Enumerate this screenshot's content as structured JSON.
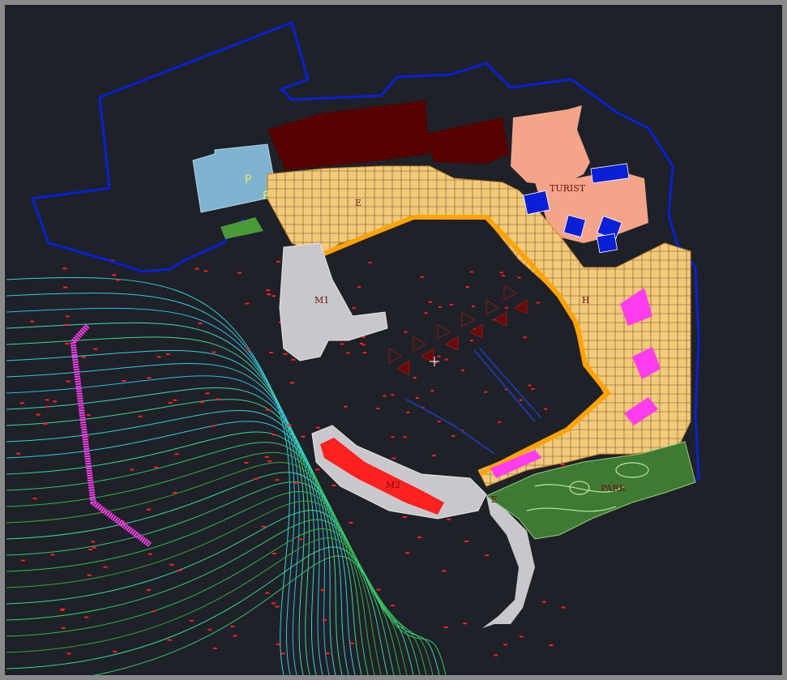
{
  "map": {
    "colors": {
      "background": "#1e2127",
      "frame": "#8a8a8a",
      "boundary": "#0a1fd8",
      "quay_fill": "#f3c97a",
      "breakwater_outline": "#ffa300",
      "building_dark": "#560000",
      "building_salmon": "#f4a488",
      "parking_fill": "#7fb3cf",
      "park_green": "#3f7a34",
      "magenta": "#ff3cf0",
      "red_marker": "#ff2020"
    },
    "labels": {
      "parking_a": "P",
      "parking_b": "P",
      "zone_e": "E",
      "zone_h": "H",
      "zone_m1": "M1",
      "zone_m2": "M2",
      "zone_e2": "E",
      "zone_turistica": "TURIST",
      "park": "PARK"
    },
    "icons": {
      "cursor": "crosshair-icon"
    }
  }
}
